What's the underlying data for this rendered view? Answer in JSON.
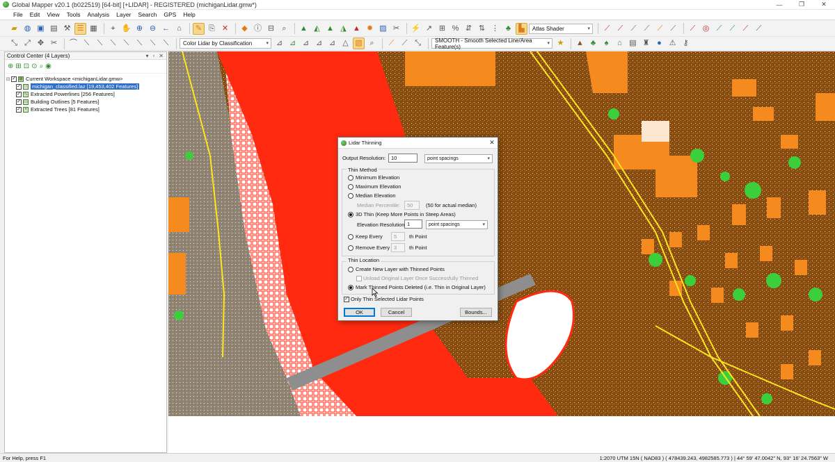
{
  "window": {
    "title": "Global Mapper v20.1 (b022519) [64-bit] [+LIDAR] - REGISTERED (michiganLidar.gmw*)",
    "minimize": "—",
    "maximize": "❐",
    "close": "✕"
  },
  "menu": [
    "File",
    "Edit",
    "View",
    "Tools",
    "Analysis",
    "Layer",
    "Search",
    "GPS",
    "Help"
  ],
  "toolbar": {
    "shader_combo": "Atlas Shader",
    "lidar_color_combo": "Color Lidar by Classification",
    "smooth_combo": "SMOOTH - Smooth Selected Line/Area Feature(s)"
  },
  "control_center": {
    "title": "Control Center (4 Layers)",
    "workspace": "Current Workspace <michiganLidar.gmw>",
    "layers": [
      {
        "label": "michigan_classified.laz [19,453,402 Features]",
        "checked": true,
        "selected": true
      },
      {
        "label": "Extracted Powerlines [256 Features]",
        "checked": true,
        "selected": false
      },
      {
        "label": "Building Outlines [5 Features]",
        "checked": true,
        "selected": false
      },
      {
        "label": "Extracted Trees [81 Features]",
        "checked": true,
        "selected": false
      }
    ]
  },
  "dialog": {
    "title": "Lidar Thinning",
    "output_resolution_label": "Output Resolution:",
    "output_resolution_value": "10",
    "output_resolution_unit": "point spacings",
    "thin_method_label": "Thin Method",
    "method_min": "Minimum Elevation",
    "method_max": "Maximum Elevation",
    "method_median": "Median Elevation",
    "median_percentile_label": "Median Percentile:",
    "median_percentile_value": "50",
    "median_percentile_hint": "(50 for actual median)",
    "method_3d": "3D Thin (Keep More Points in Steep Areas)",
    "elev_resolution_label": "Elevation Resolution:",
    "elev_resolution_value": "1",
    "elev_resolution_unit": "point spacings",
    "keep_every_label": "Keep Every",
    "keep_every_value": "5",
    "keep_every_suffix": "th Point",
    "remove_every_label": "Remove Every",
    "remove_every_value": "3",
    "remove_every_suffix": "th Point",
    "thin_location_label": "Thin Location",
    "create_new_layer": "Create New Layer with Thinned Points",
    "unload_original": "Unload Original Layer Once Successfully Thinned",
    "mark_deleted": "Mark Thinned Points Deleted (i.e. Thin in Original Layer)",
    "only_selected": "Only Thin Selected Lidar Points",
    "ok": "OK",
    "cancel": "Cancel",
    "bounds": "Bounds..."
  },
  "status": {
    "help": "For Help, press F1",
    "projection": "1:2070  UTM 15N ( NAD83 ) ( 478439.243, 4982585.773 )  |  44° 59' 47.0042\" N, 93° 16' 24.7563\" W"
  }
}
